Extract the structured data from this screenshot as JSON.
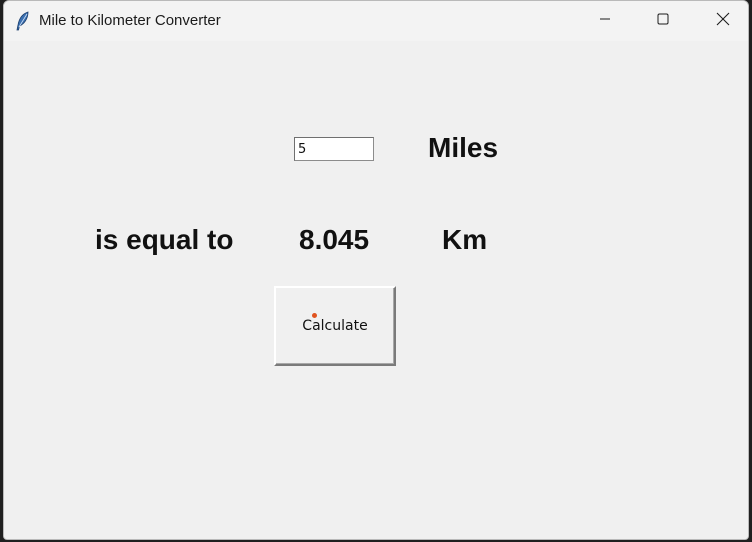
{
  "window": {
    "title": "Mile to Kilometer Converter",
    "app_icon": "feather-icon",
    "controls": {
      "minimize_icon": "minimize-icon",
      "maximize_icon": "maximize-icon",
      "close_icon": "close-icon"
    }
  },
  "form": {
    "miles_value": "5",
    "miles_label": "Miles",
    "equal_label": "is equal to",
    "result_value": "8.045",
    "km_label": "Km",
    "calculate_label": "Calculate"
  },
  "colors": {
    "background": "#f0f0f0",
    "titlebar": "#f3f3f3",
    "text": "#111111",
    "cursor_accent": "#e0531f"
  }
}
